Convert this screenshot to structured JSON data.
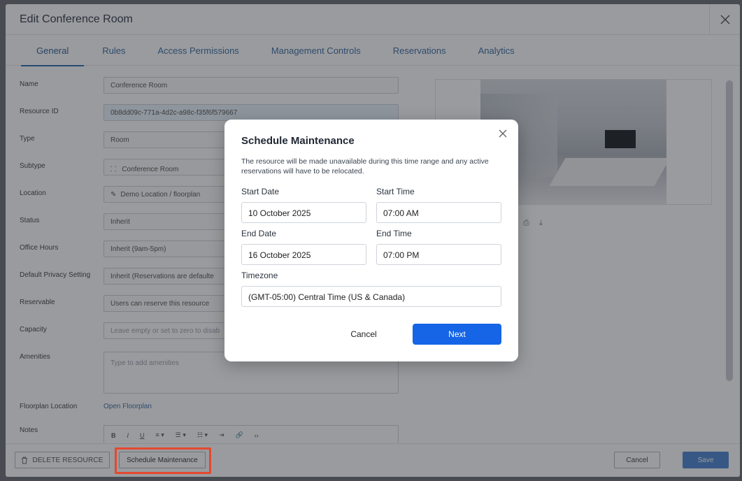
{
  "edit_modal": {
    "title": "Edit Conference Room",
    "tabs": [
      "General",
      "Rules",
      "Access Permissions",
      "Management Controls",
      "Reservations",
      "Analytics"
    ],
    "fields": {
      "name_label": "Name",
      "name_value": "Conference Room",
      "resource_id_label": "Resource ID",
      "resource_id_value": "0b8dd09c-771a-4d2c-a98c-f35f6f579667",
      "type_label": "Type",
      "type_value": "Room",
      "subtype_label": "Subtype",
      "subtype_value": "Conference Room",
      "location_label": "Location",
      "location_value": "Demo Location  /  floorplan",
      "status_label": "Status",
      "status_value": "Inherit",
      "office_hours_label": "Office Hours",
      "office_hours_value": "Inherit (9am-5pm)",
      "privacy_label": "Default Privacy Setting",
      "privacy_value": "Inherit (Reservations are defaulte",
      "reservable_label": "Reservable",
      "reservable_value": "Users can reserve this resource",
      "capacity_label": "Capacity",
      "capacity_placeholder": "Leave empty or set to zero to disab",
      "amenities_label": "Amenities",
      "amenities_placeholder": "Type to add amenities",
      "floorplan_label": "Floorplan Location",
      "floorplan_link": "Open Floorplan",
      "notes_label": "Notes"
    },
    "toolbar": [
      "B",
      "I",
      "U",
      "≡ ▾",
      "☰ ▾",
      "☷ ▾",
      "⇥",
      "🔗",
      "‹›"
    ],
    "footer": {
      "delete_label": "DELETE RESOURCE",
      "schedule_label": "Schedule Maintenance",
      "cancel_label": "Cancel",
      "save_label": "Save"
    }
  },
  "dialog": {
    "title": "Schedule Maintenance",
    "description": "The resource will be made unavailable during this time range and any active reservations will have to be relocated.",
    "start_date_label": "Start Date",
    "start_date_value": "10 October 2025",
    "start_time_label": "Start Time",
    "start_time_value": "07:00 AM",
    "end_date_label": "End Date",
    "end_date_value": "16 October 2025",
    "end_time_label": "End Time",
    "end_time_value": "07:00 PM",
    "timezone_label": "Timezone",
    "timezone_value": "(GMT-05:00) Central Time (US & Canada)",
    "cancel_label": "Cancel",
    "next_label": "Next"
  },
  "colors": {
    "accent": "#1565e6",
    "highlight": "#e5482f",
    "tab_text": "#3b6ea8"
  }
}
